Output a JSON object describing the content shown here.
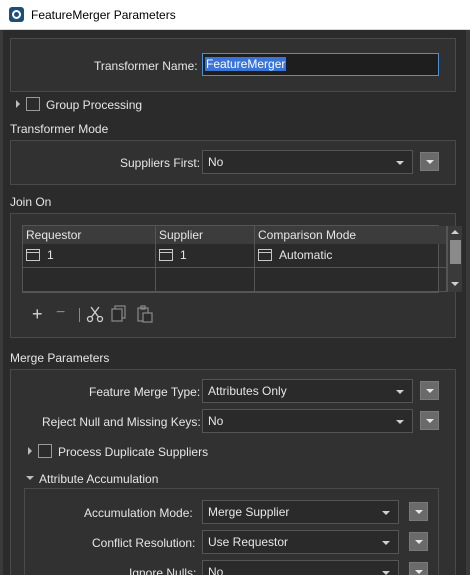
{
  "window": {
    "title": "FeatureMerger Parameters"
  },
  "transformer_name": {
    "label": "Transformer Name:",
    "value": "FeatureMerger"
  },
  "group_processing": {
    "label": "Group Processing",
    "checked": false
  },
  "transformer_mode": {
    "title": "Transformer Mode",
    "suppliers_first": {
      "label": "Suppliers First:",
      "value": "No"
    }
  },
  "join_on": {
    "title": "Join On",
    "columns": [
      "Requestor",
      "Supplier",
      "Comparison Mode"
    ],
    "rows": [
      {
        "requestor": "1",
        "supplier": "1",
        "comparison_mode": "Automatic"
      }
    ],
    "toolbar": {
      "add": "+",
      "remove": "−",
      "icons": [
        "add-icon",
        "remove-icon",
        "cut-icon",
        "copy-icon",
        "paste-icon"
      ]
    }
  },
  "merge_parameters": {
    "title": "Merge Parameters",
    "feature_merge_type": {
      "label": "Feature Merge Type:",
      "value": "Attributes Only"
    },
    "reject_null": {
      "label": "Reject Null and Missing Keys:",
      "value": "No"
    },
    "process_duplicate_suppliers": {
      "label": "Process Duplicate Suppliers",
      "checked": false
    },
    "attribute_accumulation": {
      "title": "Attribute Accumulation",
      "accumulation_mode": {
        "label": "Accumulation Mode:",
        "value": "Merge Supplier"
      },
      "conflict_resolution": {
        "label": "Conflict Resolution:",
        "value": "Use Requestor"
      },
      "ignore_nulls": {
        "label": "Ignore Nulls:",
        "value": "No"
      }
    }
  },
  "colors": {
    "background": "#2b2b2b",
    "accent": "#4a90d9",
    "selection": "#3875d7"
  }
}
